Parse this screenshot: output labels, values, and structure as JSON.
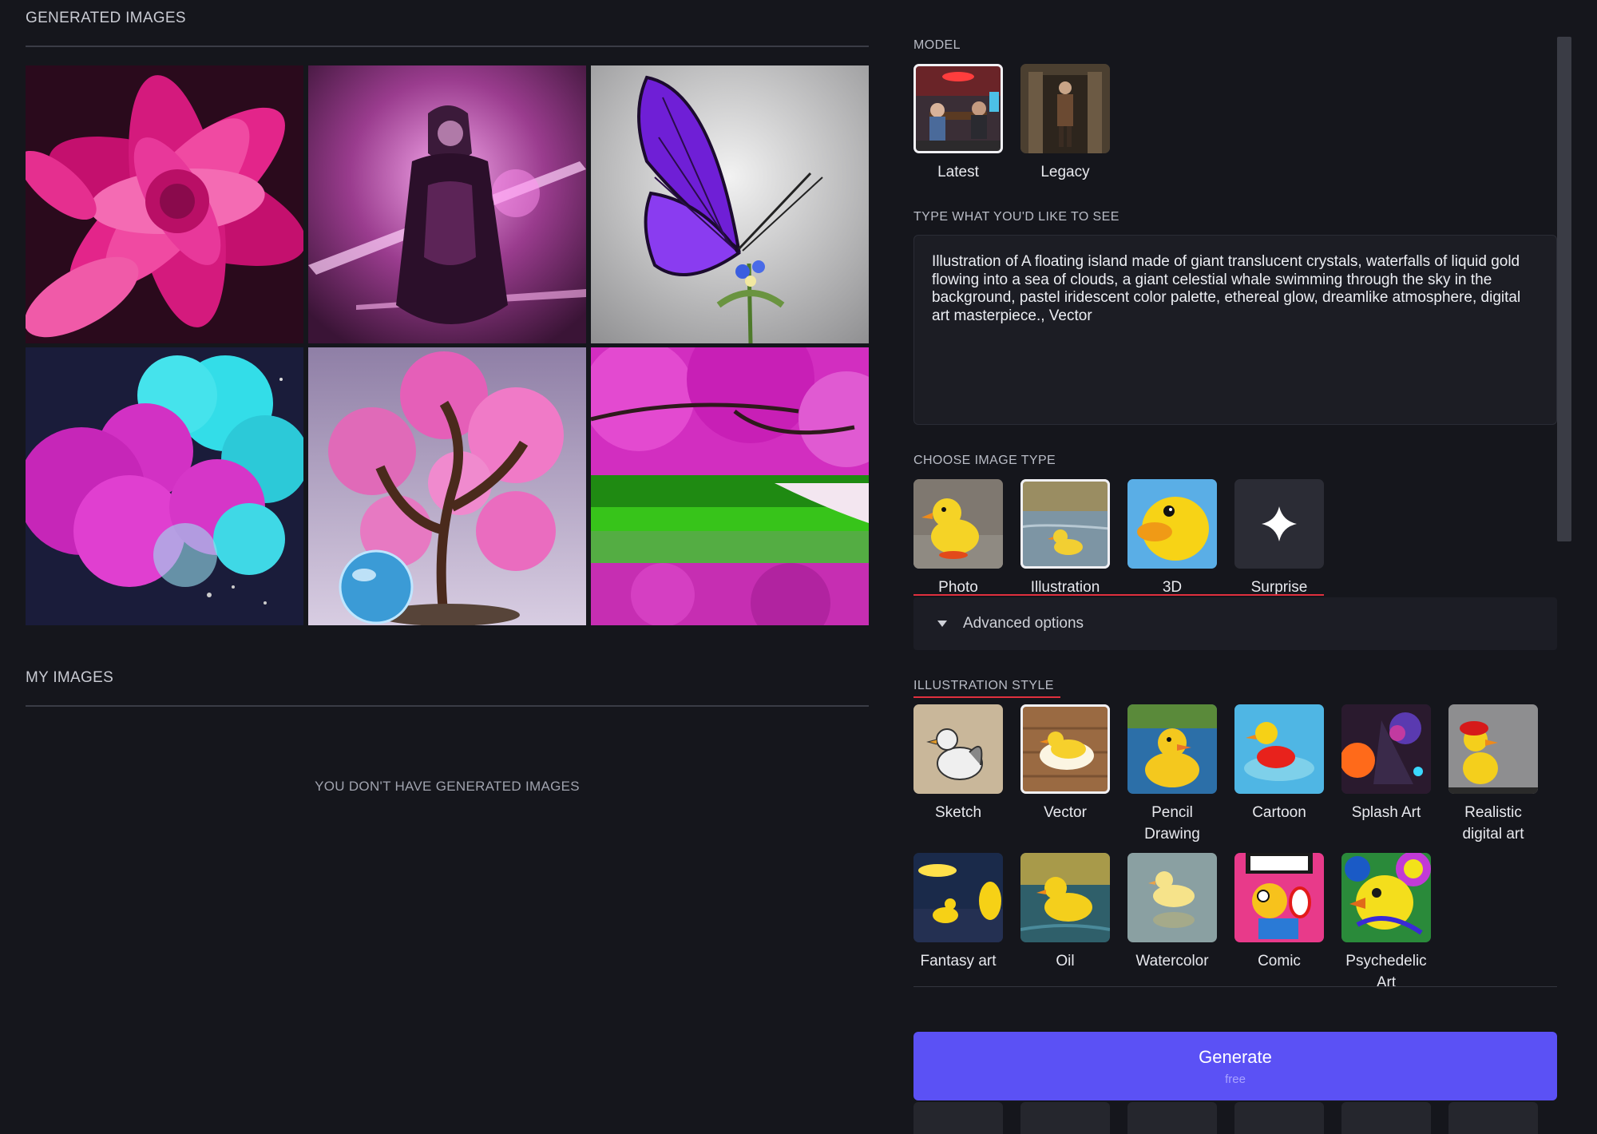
{
  "gallery": {
    "title": "GENERATED IMAGES",
    "images": [
      {
        "name": "pink-dahlia-image"
      },
      {
        "name": "sorceress-image"
      },
      {
        "name": "purple-butterfly-image"
      },
      {
        "name": "colored-smoke-image"
      },
      {
        "name": "bonsai-globe-image"
      },
      {
        "name": "cherry-blossom-river-image"
      }
    ]
  },
  "my_images": {
    "title": "MY IMAGES",
    "empty": "YOU DON'T HAVE GENERATED IMAGES"
  },
  "model": {
    "label": "MODEL",
    "options": [
      {
        "label": "Latest",
        "selected": true
      },
      {
        "label": "Legacy",
        "selected": false
      }
    ]
  },
  "prompt": {
    "label": "TYPE WHAT YOU'D LIKE TO SEE",
    "value": "Illustration of A floating island made of giant translucent crystals, waterfalls of liquid gold flowing into a sea of clouds, a giant celestial whale swimming through the sky in the background, pastel iridescent color palette, ethereal glow, dreamlike atmosphere, digital art masterpiece., Vector"
  },
  "image_type": {
    "label": "CHOOSE IMAGE TYPE",
    "options": [
      {
        "label": "Photo",
        "selected": false
      },
      {
        "label": "Illustration",
        "selected": true
      },
      {
        "label": "3D",
        "selected": false
      },
      {
        "label": "Surprise",
        "selected": false
      }
    ]
  },
  "advanced": {
    "label": "Advanced options"
  },
  "style": {
    "label": "ILLUSTRATION STYLE",
    "row1": [
      {
        "label": "Sketch"
      },
      {
        "label": "Vector",
        "selected": true
      },
      {
        "label": "Pencil Drawing"
      },
      {
        "label": "Cartoon"
      },
      {
        "label": "Splash Art"
      },
      {
        "label": "Realistic digital art"
      }
    ],
    "row2": [
      {
        "label": "Fantasy art"
      },
      {
        "label": "Oil"
      },
      {
        "label": "Watercolor"
      },
      {
        "label": "Comic"
      },
      {
        "label": "Psychedelic Art"
      }
    ]
  },
  "generate": {
    "label": "Generate",
    "sub": "free"
  },
  "colors": {
    "accent": "#5b51f5",
    "underline": "#e0303e",
    "background": "#15161c"
  }
}
